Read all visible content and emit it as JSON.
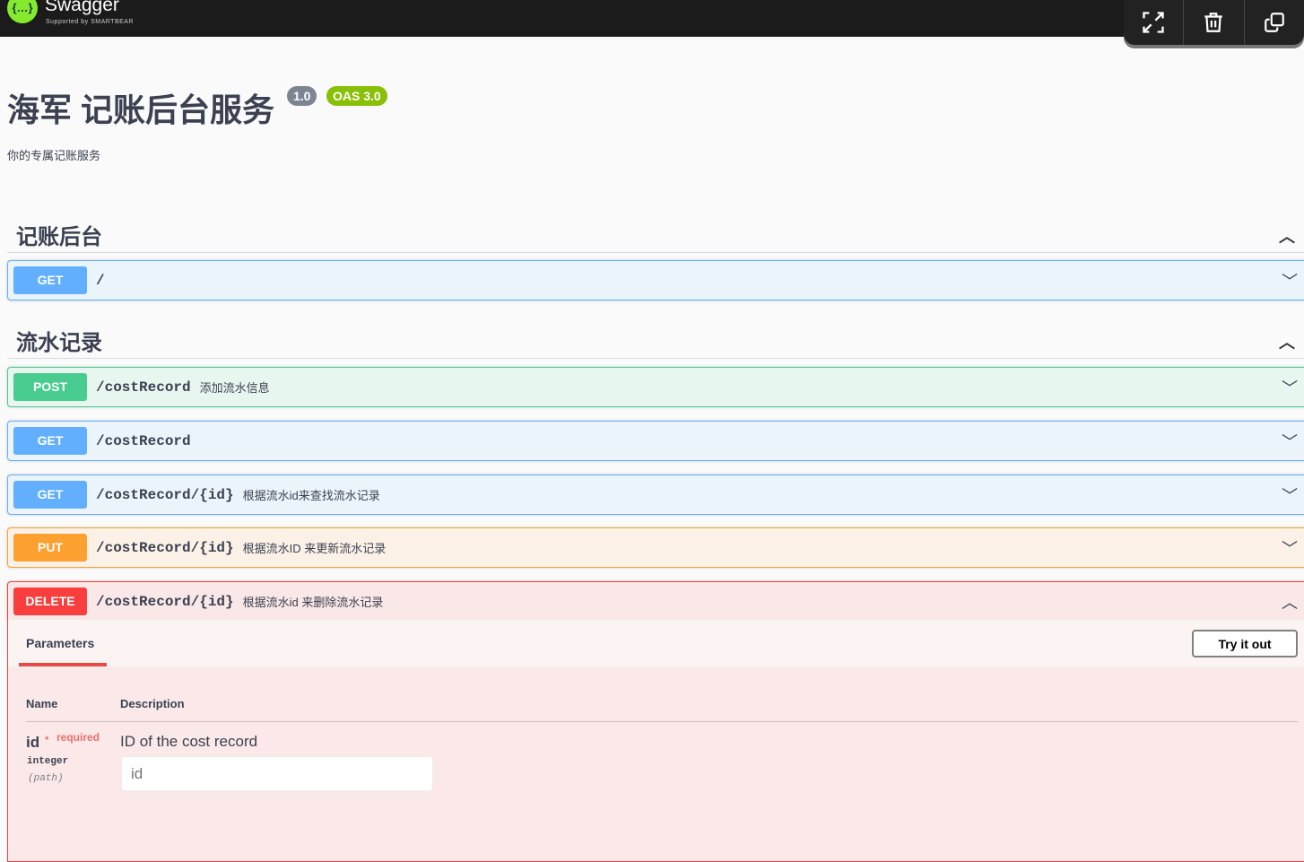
{
  "topbar": {
    "brand": "Swagger",
    "subtitle": "Supported by SMARTBEAR",
    "logo_glyph": "{…}",
    "tools": [
      "expand-icon",
      "trash-icon",
      "copy-icon"
    ]
  },
  "info": {
    "title": "海军 记账后台服务",
    "version": "1.0",
    "oas": "OAS 3.0",
    "description": "你的专属记账服务"
  },
  "tags": [
    {
      "name": "记账后台",
      "ops": [
        {
          "method": "GET",
          "path": "/",
          "summary": ""
        }
      ]
    },
    {
      "name": "流水记录",
      "ops": [
        {
          "method": "POST",
          "path": "/costRecord",
          "summary": "添加流水信息"
        },
        {
          "method": "GET",
          "path": "/costRecord",
          "summary": ""
        },
        {
          "method": "GET",
          "path": "/costRecord/{id}",
          "summary": "根据流水id来查找流水记录"
        },
        {
          "method": "PUT",
          "path": "/costRecord/{id}",
          "summary": "根据流水ID 来更新流水记录"
        },
        {
          "method": "DELETE",
          "path": "/costRecord/{id}",
          "summary": "根据流水id 来删除流水记录"
        }
      ]
    }
  ],
  "panel": {
    "tab": "Parameters",
    "try": "Try it out",
    "col_name": "Name",
    "col_desc": "Description",
    "param": {
      "name": "id",
      "star": "*",
      "required": "required",
      "type": "integer",
      "in": "(path)",
      "description": "ID of the cost record",
      "placeholder": "id"
    }
  },
  "colors": {
    "GET": "#61affe",
    "POST": "#49cc90",
    "PUT": "#fca130",
    "DELETE": "#f93e3e"
  }
}
